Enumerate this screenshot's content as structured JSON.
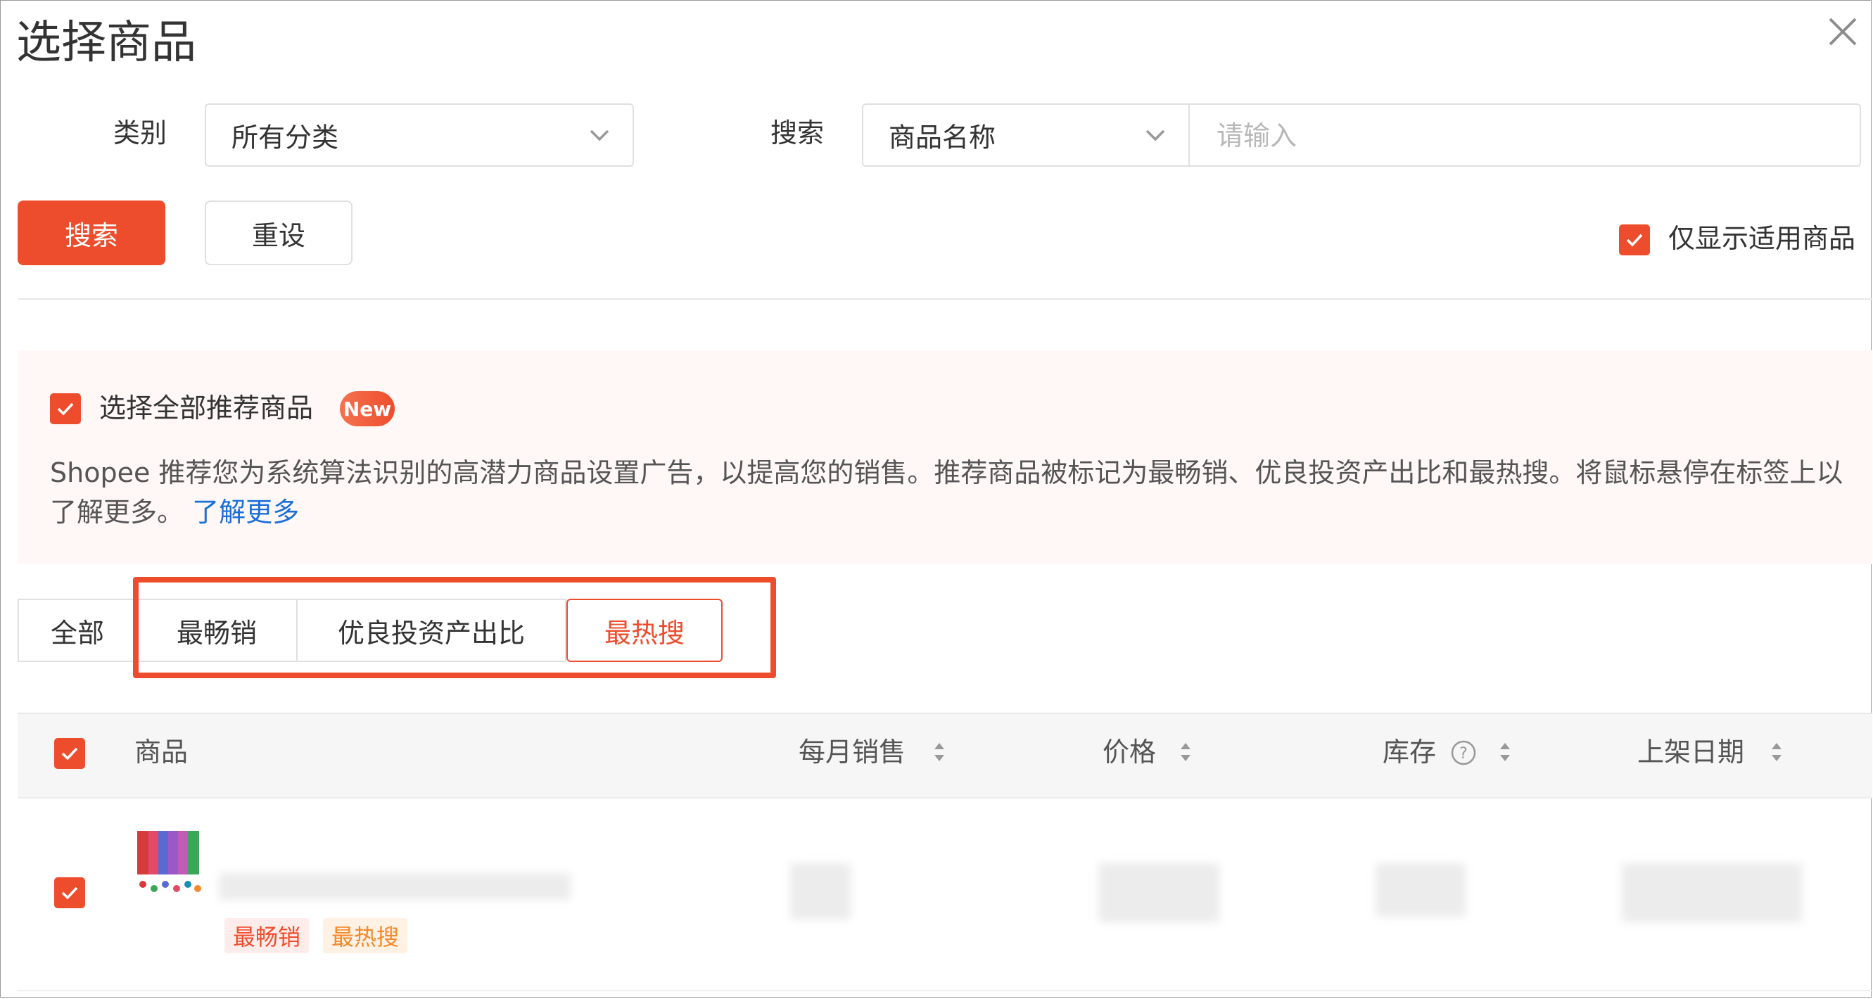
{
  "dialog": {
    "title": "选择商品"
  },
  "filters": {
    "category_label": "类别",
    "category_value": "所有分类",
    "search_label": "搜索",
    "search_type_value": "商品名称",
    "search_placeholder": "请输入"
  },
  "actions": {
    "search_button": "搜索",
    "reset_button": "重设",
    "only_applicable_label": "仅显示适用商品"
  },
  "recommend": {
    "select_all_label": "选择全部推荐商品",
    "new_badge": "New",
    "description": "Shopee 推荐您为系统算法识别的高潜力商品设置广告，以提高您的销售。推荐商品被标记为最畅销、优良投资产出比和最热搜。将鼠标悬停在标签上以了解更多。",
    "learn_more": "了解更多"
  },
  "tabs": [
    {
      "label": "全部"
    },
    {
      "label": "最畅销"
    },
    {
      "label": "优良投资产出比"
    },
    {
      "label": "最热搜"
    }
  ],
  "table": {
    "columns": {
      "product": "商品",
      "monthly_sales": "每月销售",
      "price": "价格",
      "stock": "库存",
      "listing_date": "上架日期"
    },
    "rows": [
      {
        "tags": [
          "最畅销",
          "最热搜"
        ]
      }
    ]
  },
  "colors": {
    "accent": "#ee4d2d",
    "link": "#1a6fd6",
    "notice_bg": "#fff8f6"
  },
  "icons": {
    "close": "close-icon",
    "chevron": "chevron-down-icon",
    "check": "check-icon",
    "sort": "sort-icon",
    "help": "help-icon"
  }
}
